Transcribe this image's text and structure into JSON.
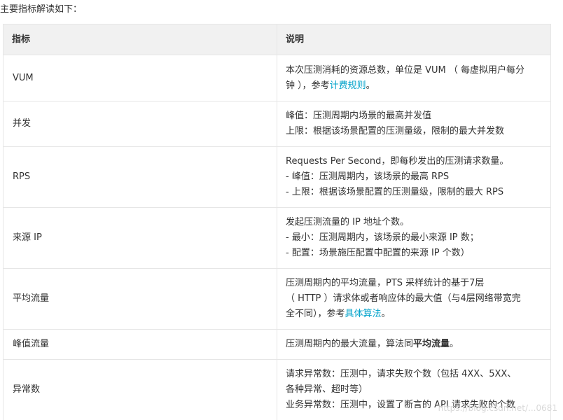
{
  "intro": "主要指标解读如下：",
  "table": {
    "headers": [
      "指标",
      "说明"
    ],
    "rows": [
      {
        "name": "VUM",
        "desc": {
          "line1": "本次压测消耗的资源总数，单位是 VUM （ 每虚拟用户每分",
          "line2_pre": "钟 ），参考",
          "link": "计费规则",
          "line2_post": "。"
        }
      },
      {
        "name": "并发",
        "desc": {
          "line1": "峰值：压测周期内场景的最高并发值",
          "line2": "上限：根据该场景配置的压测量级，限制的最大并发数"
        }
      },
      {
        "name": "RPS",
        "desc": {
          "line1": "Requests Per Second，即每秒发出的压测请求数量。",
          "line2": "- 峰值：压测周期内，该场景的最高 RPS",
          "line3": "- 上限：根据该场景配置的压测量级，限制的最大 RPS"
        }
      },
      {
        "name": "来源 IP",
        "desc": {
          "line1": "发起压测流量的 IP 地址个数。",
          "line2": "- 最小：压测周期内，该场景的最小来源 IP 数；",
          "line3": "- 配置：场景施压配置中配置的来源 IP 个数）"
        }
      },
      {
        "name": "平均流量",
        "desc": {
          "line1": "压测周期内的平均流量，PTS 采样统计的基于7层",
          "line2": "（ HTTP ）请求体或者响应体的最大值（与4层网络带宽完",
          "line3_pre": "全不同），参考",
          "link": "具体算法",
          "line3_post": "。"
        }
      },
      {
        "name": "峰值流量",
        "desc": {
          "pre": "压测周期内的最大流量，算法同",
          "bold": "平均流量",
          "post": "。"
        }
      },
      {
        "name": "异常数",
        "desc": {
          "line1": "请求异常数：压测中，请求失败个数（包括 4XX、5XX、",
          "line2": "各种异常、超时等）",
          "line3": "业务异常数：压测中，设置了断言的 API 请求失败的个数"
        }
      }
    ]
  },
  "watermark": "https://blog.csdn.net/...0681",
  "colors": {
    "link": "#00a2ca",
    "header_bg": "#f1f1f1",
    "border": "#e6e6e6"
  }
}
